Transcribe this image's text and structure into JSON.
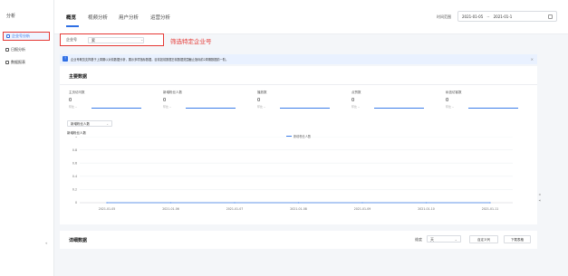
{
  "app": {
    "title": "分析"
  },
  "sidebar": {
    "items": [
      {
        "label": "企业号分析"
      },
      {
        "label": "日报分析"
      },
      {
        "label": "数据报表"
      }
    ],
    "collapse_label": "«"
  },
  "header": {
    "tabs": [
      {
        "label": "概览"
      },
      {
        "label": "视频分析"
      },
      {
        "label": "用户分析"
      },
      {
        "label": "运营分析"
      }
    ],
    "time_label": "时间范围",
    "start_date": "2021-01-05",
    "range_sep": "~",
    "end_date": "2021-01-1"
  },
  "filter": {
    "label": "企业号",
    "value": "索",
    "annotation": "筛选特定企业号"
  },
  "banner": {
    "text": "企业号概览支撑基于上周期以对前数据分析，展示多项指标数据。目前如前数据日前数据范围截止指标前2周期数据前一阶。"
  },
  "main": {
    "title": "主要数据",
    "metrics": [
      {
        "label": "主页访问数",
        "value": "0",
        "compare": "环比 --"
      },
      {
        "label": "新增粉丝人数",
        "value": "0",
        "compare": "环比 --"
      },
      {
        "label": "播放数",
        "value": "0",
        "compare": "环比 --"
      },
      {
        "label": "点赞数",
        "value": "0",
        "compare": "环比 --"
      },
      {
        "label": "私信访客数",
        "value": "0",
        "compare": "环比 --"
      }
    ],
    "chart_select": "新增粉丝人数"
  },
  "detail": {
    "title": "详细数据",
    "dim_label": "维度",
    "dim_value": "天",
    "btn_custom": "自定义列",
    "btn_download": "下载表格"
  },
  "colors": {
    "accent": "#2f6fe4",
    "line": "#3b7de9",
    "annotation": "#e53935"
  },
  "chart_data": {
    "type": "line",
    "title": "新增粉丝人数",
    "x": [
      "2021-01-05",
      "2021-01-06",
      "2021-01-07",
      "2021-01-08",
      "2021-01-09",
      "2021-01-10",
      "2021-01-11"
    ],
    "x_tick_labels": [
      "2021-01-05",
      "2021-01-06",
      "2021-01-07",
      "2021-01-08",
      "2021-01-09",
      "2021-01-10",
      "2021-01-11"
    ],
    "series": [
      {
        "name": "新增粉丝人数",
        "values": [
          0,
          0,
          0,
          0,
          0,
          0,
          0
        ]
      }
    ],
    "y_ticks": [
      0,
      0.2,
      0.4,
      0.6,
      0.8,
      1
    ],
    "ylim": [
      0,
      1
    ],
    "grid": true,
    "legend": "top-center"
  }
}
